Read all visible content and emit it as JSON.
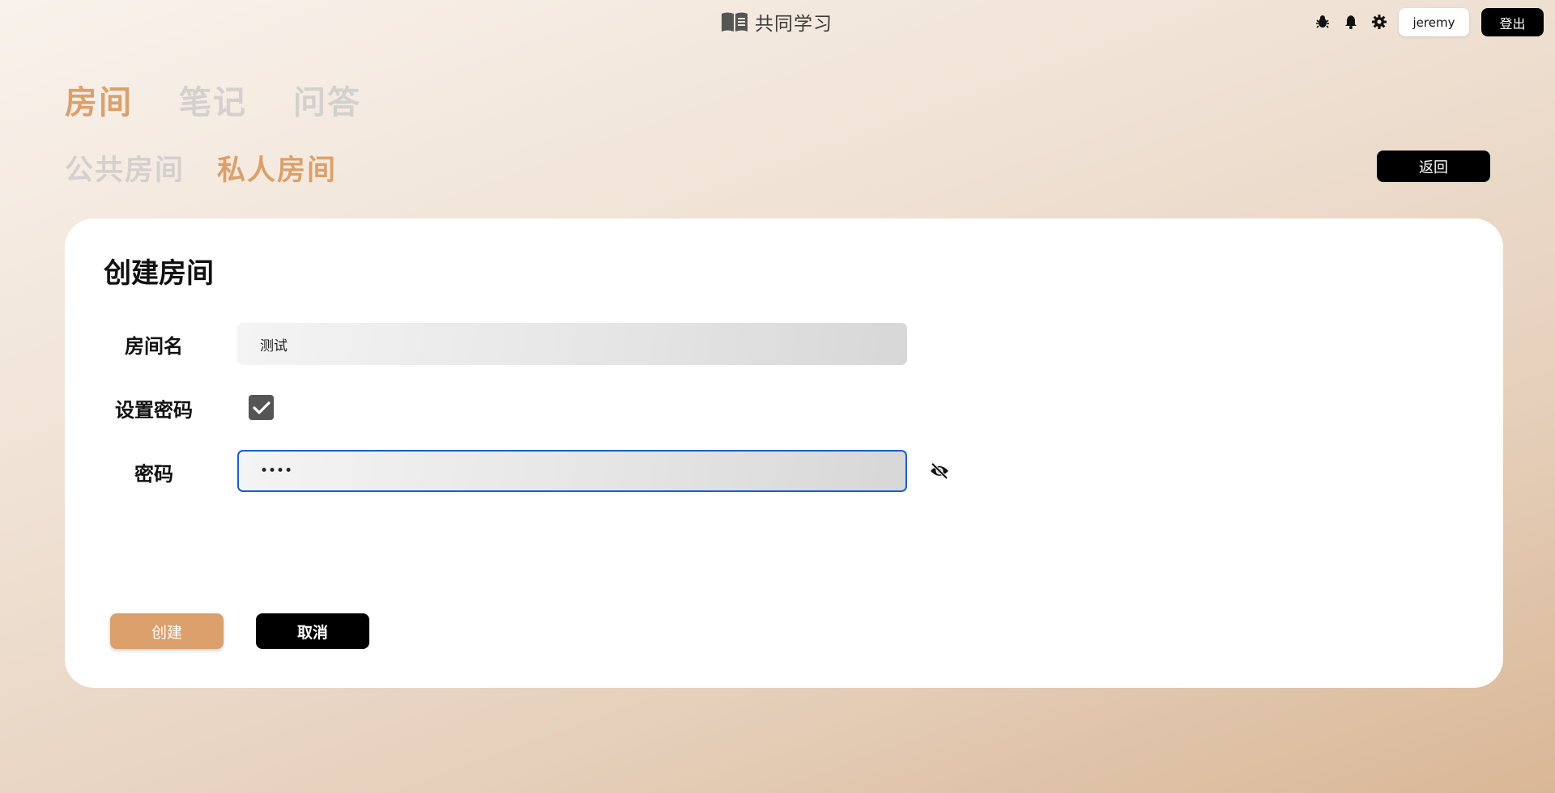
{
  "header": {
    "brand_icon": "book-icon",
    "brand_title": "共同学习",
    "icons": [
      "bug-icon",
      "bell-icon",
      "gear-icon"
    ],
    "username": "jeremy",
    "logout_label": "登出"
  },
  "nav": {
    "main_tabs": [
      {
        "label": "房间",
        "active": true
      },
      {
        "label": "笔记",
        "active": false
      },
      {
        "label": "问答",
        "active": false
      }
    ],
    "sub_tabs": [
      {
        "label": "公共房间",
        "active": false
      },
      {
        "label": "私人房间",
        "active": true
      }
    ],
    "back_label": "返回"
  },
  "form": {
    "title": "创建房间",
    "room_name_label": "房间名",
    "room_name_value": "测试",
    "set_password_label": "设置密码",
    "set_password_checked": true,
    "password_label": "密码",
    "password_value": "••••",
    "toggle_visibility_icon": "eye-slash-icon",
    "create_label": "创建",
    "cancel_label": "取消"
  },
  "colors": {
    "accent": "#dba06b",
    "inactive_tab": "#d3d0cd",
    "focus_border": "#1a5fc4"
  }
}
